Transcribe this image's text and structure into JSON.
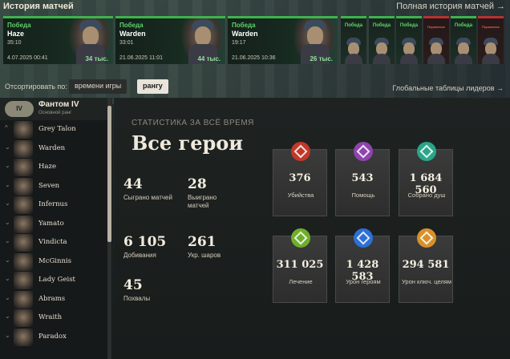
{
  "match_history": {
    "title": "История матчей",
    "full_history_label": "Полная история матчей",
    "big_cards": [
      {
        "result": "Победа",
        "hero": "Haze",
        "duration": "35:10",
        "date": "4.07.2025 00:41",
        "souls": "34 тыс."
      },
      {
        "result": "Победа",
        "hero": "Warden",
        "duration": "33:01",
        "date": "21.06.2025 11:01",
        "souls": "44 тыс."
      },
      {
        "result": "Победа",
        "hero": "Warden",
        "duration": "19:17",
        "date": "21.06.2025 10:36",
        "souls": "26 тыс."
      }
    ],
    "small_cards": [
      {
        "result": "Победа",
        "outcome": "win"
      },
      {
        "result": "Победа",
        "outcome": "win"
      },
      {
        "result": "Победа",
        "outcome": "win"
      },
      {
        "result": "Поражение",
        "outcome": "loss"
      },
      {
        "result": "Победа",
        "outcome": "win"
      },
      {
        "result": "Поражение",
        "outcome": "loss"
      }
    ]
  },
  "sort": {
    "label": "Отсортировать по:",
    "options": [
      "времени игры",
      "рангу"
    ],
    "selected": "рангу"
  },
  "global_leaderboards_label": "Глобальные таблицы лидеров",
  "sidebar": {
    "rank_badge": "IV",
    "rank_name": "Фантом IV",
    "rank_sub": "Основной ранг",
    "heroes": [
      "Grey Talon",
      "Warden",
      "Haze",
      "Seven",
      "Infernus",
      "Yamato",
      "Vindicta",
      "McGinnis",
      "Lady Geist",
      "Abrams",
      "Wraith",
      "Paradox"
    ]
  },
  "main": {
    "subtitle": "СТАТИСТИКА ЗА ВСЁ ВРЕМЯ",
    "title": "Все герои",
    "stats": [
      {
        "value": "44",
        "label": "Сыграно матчей"
      },
      {
        "value": "28",
        "label": "Выиграно матчей"
      },
      {
        "value": "6 105",
        "label": "Добивания"
      },
      {
        "value": "261",
        "label": "Укр. шаров"
      },
      {
        "value": "45",
        "label": "Похвалы"
      }
    ],
    "tiles": [
      {
        "value": "376",
        "label": "Убийства",
        "icon": "crosshair-icon",
        "color": "#c0392b"
      },
      {
        "value": "543",
        "label": "Помощь",
        "icon": "assist-icon",
        "color": "#8e44ad"
      },
      {
        "value": "1 684 560",
        "label": "Собрано душ",
        "icon": "souls-icon",
        "color": "#2aa58a"
      },
      {
        "value": "311 025",
        "label": "Лечение",
        "icon": "heal-icon",
        "color": "#6fae2a"
      },
      {
        "value": "1 428 583",
        "label": "Урон героям",
        "icon": "hero-damage-icon",
        "color": "#2d6fd6"
      },
      {
        "value": "294 581",
        "label": "Урон ключ. целям",
        "icon": "objective-damage-icon",
        "color": "#d9902a"
      }
    ]
  }
}
